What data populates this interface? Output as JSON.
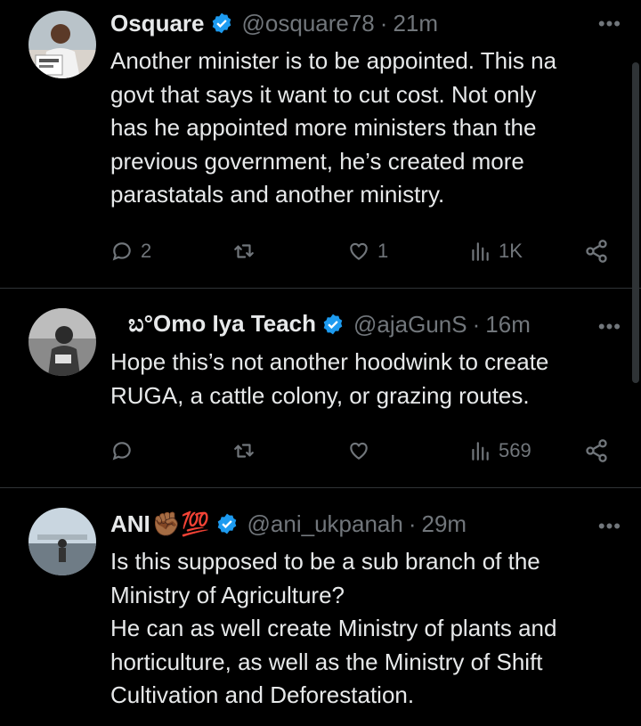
{
  "tweets": [
    {
      "name": "Osquare",
      "handle": "@osquare78",
      "dot": "·",
      "time": "21m",
      "more": "•••",
      "body_lines": [
        "Another minister is to be appointed. This na",
        "govt that says it want to cut cost. Not only",
        "has he appointed more ministers than the",
        "previous government, he’s created more",
        "parastatals and another ministry."
      ],
      "actions": {
        "replies": "2",
        "retweets": "",
        "likes": "1",
        "views": "1K"
      }
    },
    {
      "name": "ಬ°Omo Iya Teach",
      "handle": "@ajaGunS",
      "dot": "·",
      "time": "16m",
      "more": "•••",
      "body_lines": [
        "Hope this’s not another hoodwink to create",
        "RUGA, a cattle colony, or grazing routes."
      ],
      "actions": {
        "replies": "",
        "retweets": "",
        "likes": "",
        "views": "569"
      }
    },
    {
      "name": "ANI",
      "name_emoji": "✊🏾💯",
      "handle": "@ani_ukpanah",
      "dot": "·",
      "time": "29m",
      "more": "•••",
      "body_lines": [
        "Is this supposed to be a sub branch of the",
        "Ministry of Agriculture?",
        "He can as well create Ministry of plants and",
        "horticulture, as well as the Ministry of Shift",
        "Cultivation and Deforestation."
      ]
    }
  ],
  "colors": {
    "background": "#000000",
    "text": "#e7e9ea",
    "secondary": "#71767b",
    "verified": "#1d9bf0",
    "divider": "#2f3336"
  }
}
